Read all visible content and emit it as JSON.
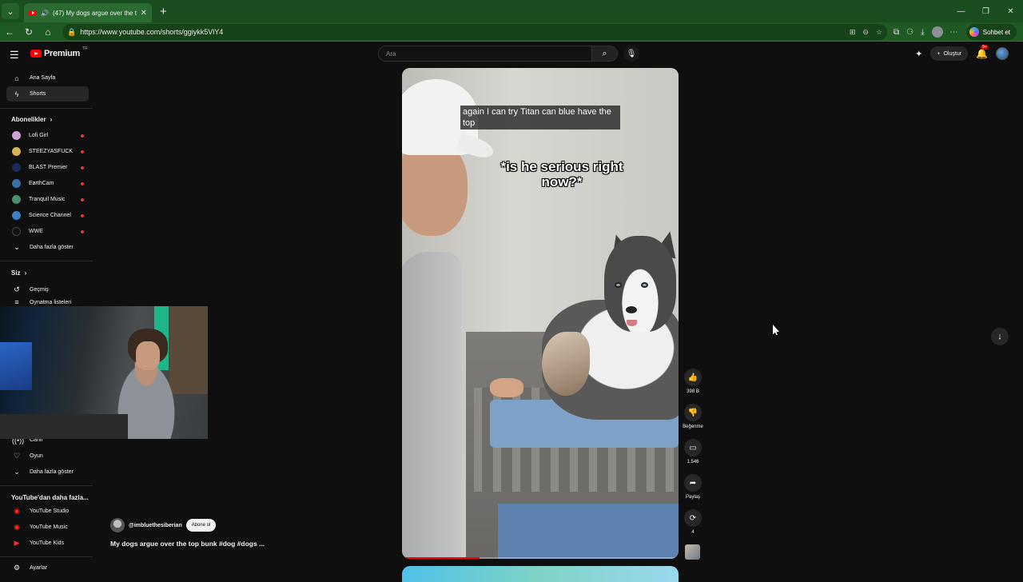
{
  "browser": {
    "tab_title": "(47) My dogs argue over the t",
    "url": "https://www.youtube.com/shorts/ggiykk5VlY4",
    "copilot_label": "Sohbet et"
  },
  "header": {
    "logo_text": "Premium",
    "logo_sup": "TR",
    "search_placeholder": "Ara",
    "create_label": "Oluştur",
    "notification_count": "9+"
  },
  "sidebar": {
    "home": "Ana Sayfa",
    "shorts": "Shorts",
    "subs_heading": "Abonelikler",
    "subscriptions": [
      {
        "name": "Lofi Girl",
        "color": "#c9a3d6"
      },
      {
        "name": "STEEZYASFUCK",
        "color": "#d4b35a"
      },
      {
        "name": "BLAST Premier",
        "color": "#1c2b5a"
      },
      {
        "name": "EarthCam",
        "color": "#3a6ea5"
      },
      {
        "name": "Tranquil Music",
        "color": "#4a8f6b"
      },
      {
        "name": "Science Channel",
        "color": "#3d7fc1"
      },
      {
        "name": "WWE",
        "color": "#111111"
      }
    ],
    "show_more": "Daha fazla göster",
    "you_heading": "Siz",
    "history": "Geçmiş",
    "playlists": "Oynatma listeleri",
    "live": "Canlı",
    "gaming": "Oyun",
    "show_more_2": "Daha fazla göster",
    "more_from_yt": "YouTube'dan daha fazla...",
    "yt_studio": "YouTube Studio",
    "yt_music": "YouTube Music",
    "yt_kids": "YouTube Kids",
    "settings": "Ayarlar"
  },
  "short": {
    "caption": "again I can try Titan can blue have the top",
    "meme_text": "*is he serious right now?*",
    "channel": "@imbluethesiberian",
    "subscribe_label": "Abone ol",
    "title": "My dogs argue over the top bunk #dog #dogs ...",
    "progress_fraction": 0.28
  },
  "actions": {
    "likes": "398 B",
    "dislike_label": "Beğenme",
    "comments": "1.546",
    "share_label": "Paylaş",
    "remix_count": "4"
  }
}
